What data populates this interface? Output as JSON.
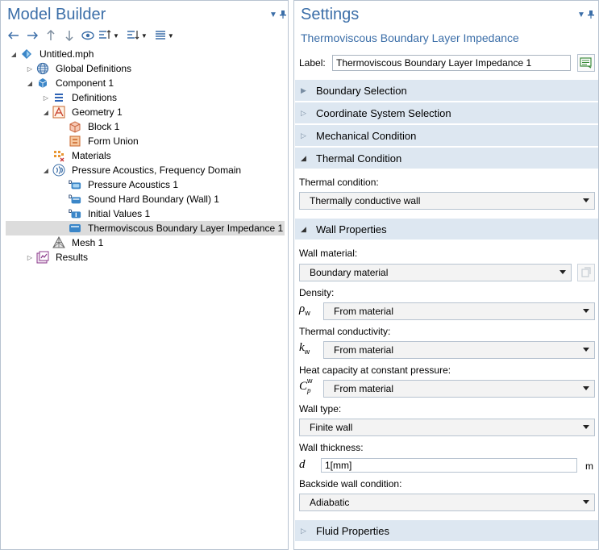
{
  "left": {
    "title": "Model Builder",
    "pin_icon": "pin-icon",
    "menu_icon": "chevron-down-icon",
    "toolbar": [
      {
        "name": "back-button",
        "glyph": "⇠"
      },
      {
        "name": "forward-button",
        "glyph": "⇢"
      },
      {
        "name": "up-button",
        "glyph": "↑"
      },
      {
        "name": "down-button",
        "glyph": "↓"
      }
    ],
    "tree": [
      {
        "label": "Untitled.mph",
        "level": 0,
        "twisty": "open",
        "icon": "model-icon"
      },
      {
        "label": "Global Definitions",
        "level": 1,
        "twisty": "closed",
        "icon": "globe-icon"
      },
      {
        "label": "Component 1",
        "level": 1,
        "twisty": "open",
        "icon": "component-icon"
      },
      {
        "label": "Definitions",
        "level": 2,
        "twisty": "closed",
        "icon": "definitions-icon"
      },
      {
        "label": "Geometry 1",
        "level": 2,
        "twisty": "open",
        "icon": "geometry-icon"
      },
      {
        "label": "Block 1",
        "level": 3,
        "twisty": "none",
        "icon": "block-icon"
      },
      {
        "label": "Form Union",
        "level": 3,
        "twisty": "none",
        "icon": "form-union-icon"
      },
      {
        "label": "Materials",
        "level": 2,
        "twisty": "none",
        "icon": "materials-icon"
      },
      {
        "label": "Pressure Acoustics, Frequency Domain",
        "level": 2,
        "twisty": "open",
        "icon": "acoustics-icon"
      },
      {
        "label": "Pressure Acoustics 1",
        "level": 3,
        "twisty": "none",
        "icon": "default-domain-icon"
      },
      {
        "label": "Sound Hard Boundary (Wall) 1",
        "level": 3,
        "twisty": "none",
        "icon": "default-boundary-icon"
      },
      {
        "label": "Initial Values 1",
        "level": 3,
        "twisty": "none",
        "icon": "default-initial-icon"
      },
      {
        "label": "Thermoviscous Boundary Layer Impedance 1",
        "level": 3,
        "twisty": "none",
        "icon": "boundary-feature-icon",
        "selected": true
      },
      {
        "label": "Mesh 1",
        "level": 2,
        "twisty": "none",
        "icon": "mesh-icon"
      },
      {
        "label": "Results",
        "level": 1,
        "twisty": "closed",
        "icon": "results-icon"
      }
    ]
  },
  "right": {
    "title": "Settings",
    "subtitle": "Thermoviscous Boundary Layer Impedance",
    "label_caption": "Label:",
    "label_value": "Thermoviscous Boundary Layer Impedance 1",
    "sections": {
      "boundary_selection": "Boundary Selection",
      "coordinate_system": "Coordinate System Selection",
      "mechanical_condition": "Mechanical Condition",
      "thermal_condition": "Thermal Condition",
      "wall_properties": "Wall Properties",
      "fluid_properties": "Fluid Properties"
    },
    "thermal": {
      "label": "Thermal condition:",
      "value": "Thermally conductive wall"
    },
    "wall": {
      "material_label": "Wall material:",
      "material_value": "Boundary material",
      "density_label": "Density:",
      "density_symbol": "ρ",
      "density_sub": "w",
      "density_value": "From material",
      "conductivity_label": "Thermal conductivity:",
      "conductivity_symbol": "k",
      "conductivity_sub": "w",
      "conductivity_value": "From material",
      "heat_capacity_label": "Heat capacity at constant pressure:",
      "heat_capacity_symbol": "C",
      "heat_capacity_sub": "p",
      "heat_capacity_sup": "w",
      "heat_capacity_value": "From material",
      "wall_type_label": "Wall type:",
      "wall_type_value": "Finite wall",
      "thickness_label": "Wall thickness:",
      "thickness_symbol": "d",
      "thickness_value": "1[mm]",
      "thickness_unit": "m",
      "backside_label": "Backside wall condition:",
      "backside_value": "Adiabatic"
    }
  },
  "colors": {
    "accent": "#3b6ea8",
    "section_bg": "#dde7f1",
    "selected_row": "#dcdcdc",
    "border": "#b7c3d0"
  }
}
